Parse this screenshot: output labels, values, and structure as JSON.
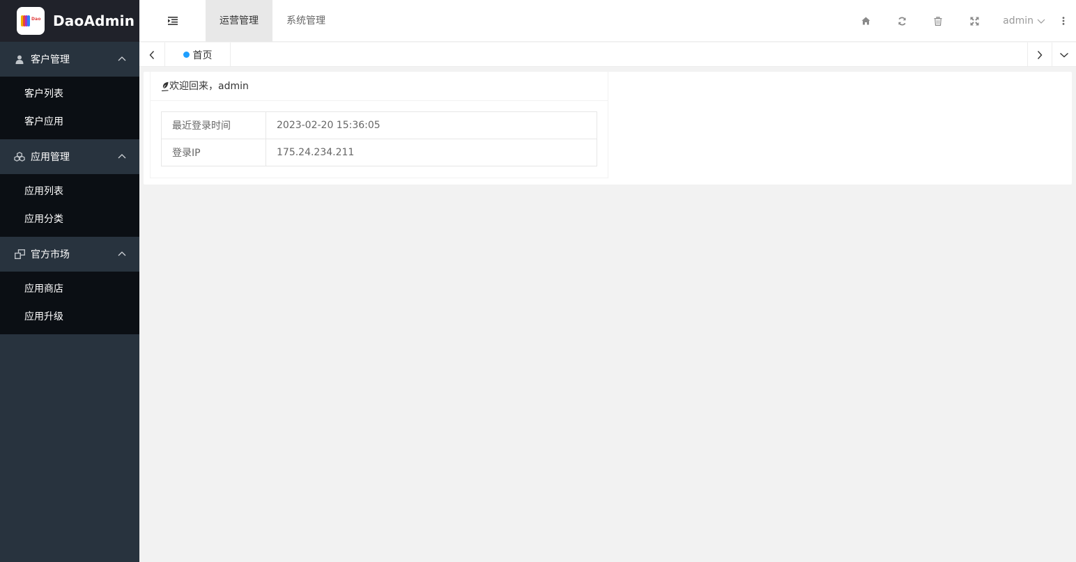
{
  "app": {
    "title": "DaoAdmin",
    "logo_text": "Dao"
  },
  "header": {
    "tabs": [
      {
        "label": "运营管理",
        "active": true
      },
      {
        "label": "系统管理",
        "active": false
      }
    ],
    "user": "admin",
    "tool_icons": [
      "home-icon",
      "refresh-icon",
      "trash-icon",
      "fullscreen-icon"
    ]
  },
  "sidebar": {
    "groups": [
      {
        "label": "客户管理",
        "icon": "user-icon",
        "items": [
          "客户列表",
          "客户应用"
        ]
      },
      {
        "label": "应用管理",
        "icon": "cubes-icon",
        "items": [
          "应用列表",
          "应用分类"
        ]
      },
      {
        "label": "官方市场",
        "icon": "windows-icon",
        "items": [
          "应用商店",
          "应用升级"
        ]
      }
    ]
  },
  "tabsbar": {
    "home_tab": "首页"
  },
  "welcome": {
    "title": "欢迎回来，admin",
    "rows": [
      {
        "key": "最近登录时间",
        "value": "2023-02-20 15:36:05"
      },
      {
        "key": "登录IP",
        "value": "175.24.234.211"
      }
    ]
  },
  "colors": {
    "sidebar_bg": "#28333e",
    "sidebar_logo_bg": "#20222a",
    "submenu_bg": "#0b0f14",
    "accent_dot": "#1e9fff",
    "content_bg": "#f2f2f2"
  }
}
